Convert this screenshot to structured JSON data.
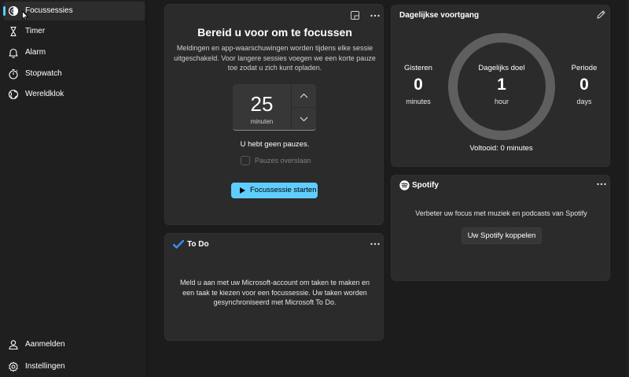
{
  "sidebar": {
    "items": [
      {
        "label": "Focussessies",
        "icon": "focus-icon"
      },
      {
        "label": "Timer",
        "icon": "hourglass-icon"
      },
      {
        "label": "Alarm",
        "icon": "bell-icon"
      },
      {
        "label": "Stopwatch",
        "icon": "stopwatch-icon"
      },
      {
        "label": "Wereldklok",
        "icon": "globe-icon"
      }
    ],
    "bottom_items": [
      {
        "label": "Aanmelden",
        "icon": "person-icon"
      },
      {
        "label": "Instellingen",
        "icon": "gear-icon"
      }
    ]
  },
  "focus": {
    "title": "Bereid u voor om te focussen",
    "description": "Meldingen en app-waarschuwingen worden tijdens elke sessie uitgeschakeld. Voor langere sessies voegen we een korte pauze toe zodat u zich kunt opladen.",
    "timer_value": "25",
    "timer_unit": "minuten",
    "no_breaks": "U hebt geen pauzes.",
    "skip_breaks_label": "Pauzes overslaan",
    "start_button": "Focussessie starten"
  },
  "todo": {
    "title": "To Do",
    "text": "Meld u aan met uw Microsoft-account om taken te maken en een taak te kiezen voor een focussessie. Uw taken worden gesynchroniseerd met Microsoft To Do."
  },
  "progress": {
    "title": "Dagelijkse voortgang",
    "yesterday": {
      "label": "Gisteren",
      "value": "0",
      "unit": "minutes"
    },
    "goal": {
      "label": "Dagelijks doel",
      "value": "1",
      "unit": "hour"
    },
    "streak": {
      "label": "Periode",
      "value": "0",
      "unit": "days"
    },
    "completed": "Voltooid: 0 minutes",
    "ring_progress": 0
  },
  "spotify": {
    "brand": "Spotify",
    "text": "Verbeter uw focus met muziek en podcasts van Spotify",
    "button": "Uw Spotify koppelen"
  },
  "colors": {
    "accent": "#60cdff",
    "background": "#1c1c1c",
    "card": "#2b2b2b",
    "ring": "#5f5f5f"
  }
}
